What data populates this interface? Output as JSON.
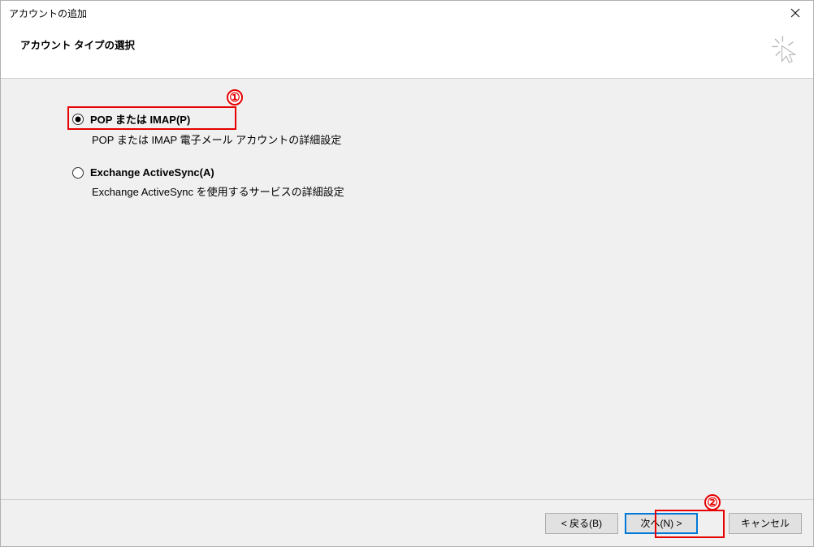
{
  "titlebar": {
    "title": "アカウントの追加"
  },
  "header": {
    "heading": "アカウント タイプの選択"
  },
  "options": {
    "pop_imap": {
      "label": "POP または IMAP(P)",
      "desc": "POP または IMAP 電子メール アカウントの詳細設定"
    },
    "eas": {
      "label": "Exchange ActiveSync(A)",
      "desc": "Exchange ActiveSync を使用するサービスの詳細設定"
    }
  },
  "buttons": {
    "back": "< 戻る(B)",
    "next": "次へ(N) >",
    "cancel": "キャンセル"
  },
  "annotations": {
    "one": "①",
    "two": "②"
  }
}
